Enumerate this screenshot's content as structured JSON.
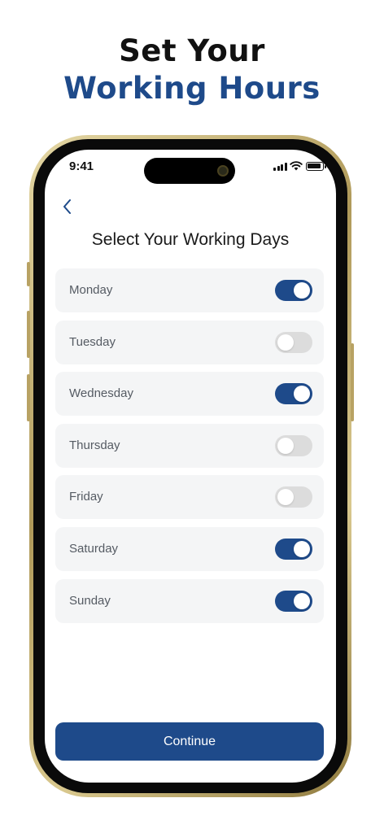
{
  "headline": {
    "line1": "Set Your",
    "line2": "Working Hours"
  },
  "status_bar": {
    "time": "9:41",
    "icons": [
      "signal-icon",
      "wifi-icon",
      "battery-icon"
    ]
  },
  "nav": {
    "back_icon": "chevron-left-icon"
  },
  "title": "Select Your Working Days",
  "days": [
    {
      "label": "Monday",
      "enabled": true
    },
    {
      "label": "Tuesday",
      "enabled": false
    },
    {
      "label": "Wednesday",
      "enabled": true
    },
    {
      "label": "Thursday",
      "enabled": false
    },
    {
      "label": "Friday",
      "enabled": false
    },
    {
      "label": "Saturday",
      "enabled": true
    },
    {
      "label": "Sunday",
      "enabled": true
    }
  ],
  "continue_label": "Continue",
  "colors": {
    "accent": "#1e4a8a",
    "toggle_off": "#dcdcdc",
    "row_bg": "#f4f5f6",
    "frame_gold": "#c8b478"
  }
}
